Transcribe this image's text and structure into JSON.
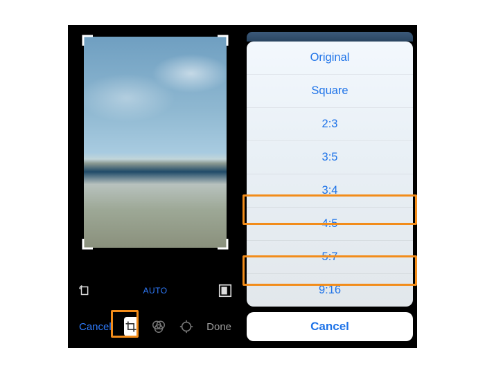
{
  "editor": {
    "auto_label": "AUTO",
    "cancel_label": "Cancel",
    "done_label": "Done"
  },
  "sheet": {
    "items": [
      "Original",
      "Square",
      "2:3",
      "3:5",
      "3:4",
      "4:5",
      "5:7",
      "9:16"
    ],
    "cancel_label": "Cancel"
  },
  "highlights": {
    "left_tool": "crop-button",
    "right_rows": [
      "4:5",
      "9:16"
    ]
  },
  "colors": {
    "accent": "#1e73e8",
    "highlight": "#f28c1a"
  }
}
